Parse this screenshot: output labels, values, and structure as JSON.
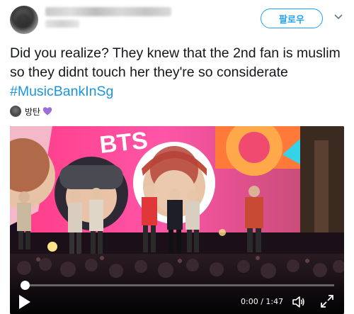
{
  "header": {
    "follow_label": "팔로우"
  },
  "tweet": {
    "text": "Did you realize? They knew that the 2nd fan is muslim so they didnt touch her they're so considerate ",
    "hashtag": "#MusicBankInSg",
    "accent_color": "#1da1f2",
    "hashtag_color": "#1b95e0"
  },
  "meta": {
    "name": "방탄",
    "heart_icon": "purple-heart-icon",
    "heart_color": "#9b6fd6"
  },
  "video": {
    "stage_sign": "BTS",
    "current_time": "0:00",
    "separator": " / ",
    "duration": "1:47",
    "progress": 0.0
  }
}
